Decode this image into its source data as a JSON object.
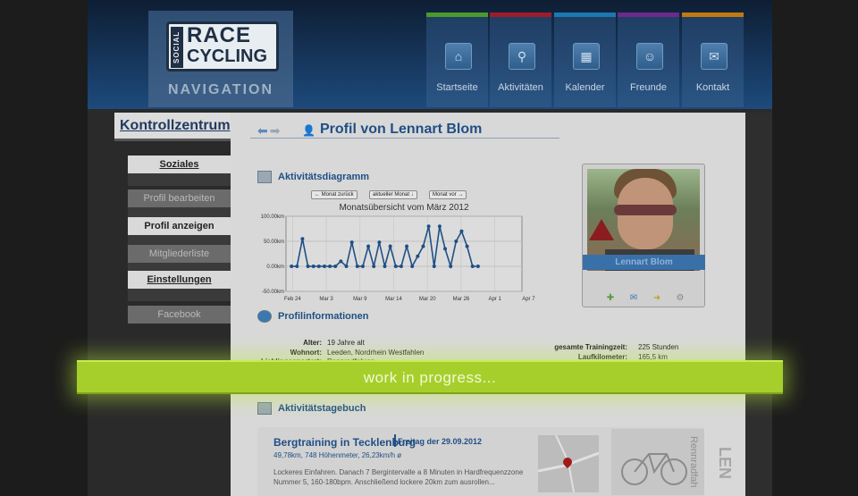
{
  "logo": {
    "social": "SOCIAL",
    "race": "RACE",
    "cycling": "CYCLING"
  },
  "nav": {
    "title": "NAVIGATION",
    "items": [
      {
        "label": "Startseite",
        "color": "#4a9a2e",
        "icon": "home-icon"
      },
      {
        "label": "Aktivitäten",
        "color": "#a01c2a",
        "icon": "bike-icon"
      },
      {
        "label": "Kalender",
        "color": "#1c78b0",
        "icon": "calendar-icon"
      },
      {
        "label": "Freunde",
        "color": "#6c2a8a",
        "icon": "friends-icon"
      },
      {
        "label": "Kontakt",
        "color": "#c07a10",
        "icon": "mail-icon"
      }
    ]
  },
  "sidebar": {
    "title": "Kontrollzentrum",
    "items": [
      {
        "label": "Soziales"
      },
      {
        "label": "Profil bearbeiten"
      },
      {
        "label": "Profil anzeigen"
      },
      {
        "label": "Mitgliederliste"
      },
      {
        "label": "Einstellungen"
      },
      {
        "label": "Facebook"
      }
    ]
  },
  "profile": {
    "title": "Profil von Lennart Blom",
    "name": "Lennart Blom"
  },
  "activity_chart": {
    "section_title": "Aktivitätsdiagramm",
    "buttons": {
      "prev": "← Monat zurück",
      "current": "aktueller Monat ↓",
      "next": "Monat vor →"
    }
  },
  "chart_data": {
    "type": "line",
    "title": "Monatsübersicht vom März 2012",
    "x_labels": [
      "Feb 24",
      "Mar 3",
      "Mar 9",
      "Mar 14",
      "Mar 20",
      "Mar 26",
      "Apr 1",
      "Apr 7"
    ],
    "y_labels": [
      "100.00km",
      "50.00km",
      "0.00km",
      "-50.00km"
    ],
    "ylim": [
      -50,
      100
    ],
    "xlim": [
      0,
      43
    ],
    "grid": true,
    "series": [
      {
        "x": [
          1,
          2,
          3,
          4,
          5,
          6,
          7,
          8,
          9,
          10,
          11,
          12,
          13,
          14,
          15,
          16,
          17,
          18,
          19,
          20,
          21,
          22,
          23,
          24,
          25,
          26,
          27,
          28,
          29,
          30,
          31,
          32,
          33,
          34,
          35
        ],
        "values": [
          0,
          0,
          55,
          0,
          0,
          0,
          0,
          0,
          0,
          10,
          0,
          48,
          0,
          0,
          40,
          0,
          48,
          0,
          40,
          0,
          0,
          40,
          0,
          20,
          40,
          80,
          0,
          80,
          35,
          0,
          50,
          70,
          40,
          0,
          0
        ]
      }
    ]
  },
  "profile_info": {
    "section_title": "Profilinformationen",
    "left": [
      {
        "label": "Alter:",
        "value": "19 Jahre alt"
      },
      {
        "label": "Wohnort:",
        "value": "Leeden, Nordrhein Westfahlen"
      },
      {
        "label": "Lieblingssportart:",
        "value": "Rennradfahren"
      }
    ],
    "right": [
      {
        "label": "gesamte Trainingzeit:",
        "value": "225 Stunden"
      },
      {
        "label": "Laufkilometer:",
        "value": "165,5 km"
      }
    ]
  },
  "banner": {
    "text": "work in progress..."
  },
  "diary": {
    "section_title": "Aktivitätstagebuch",
    "entry_title": "Bergtraining in Tecklenburg",
    "entry_date": "Freitag der 29.09.2012",
    "entry_stats": "49,78km, 748 Höhenmeter, 26,23km/h ø",
    "entry_text": "Lockeres Einfahren. Danach 7 Bergintervalle a 8 Minuten in Hardfrequenzzone Nummer 5, 160-180bpm. Anschließend lockere 20km zum ausrollen...",
    "side_label": "Rennradfah",
    "big_side_label": "LEN"
  }
}
